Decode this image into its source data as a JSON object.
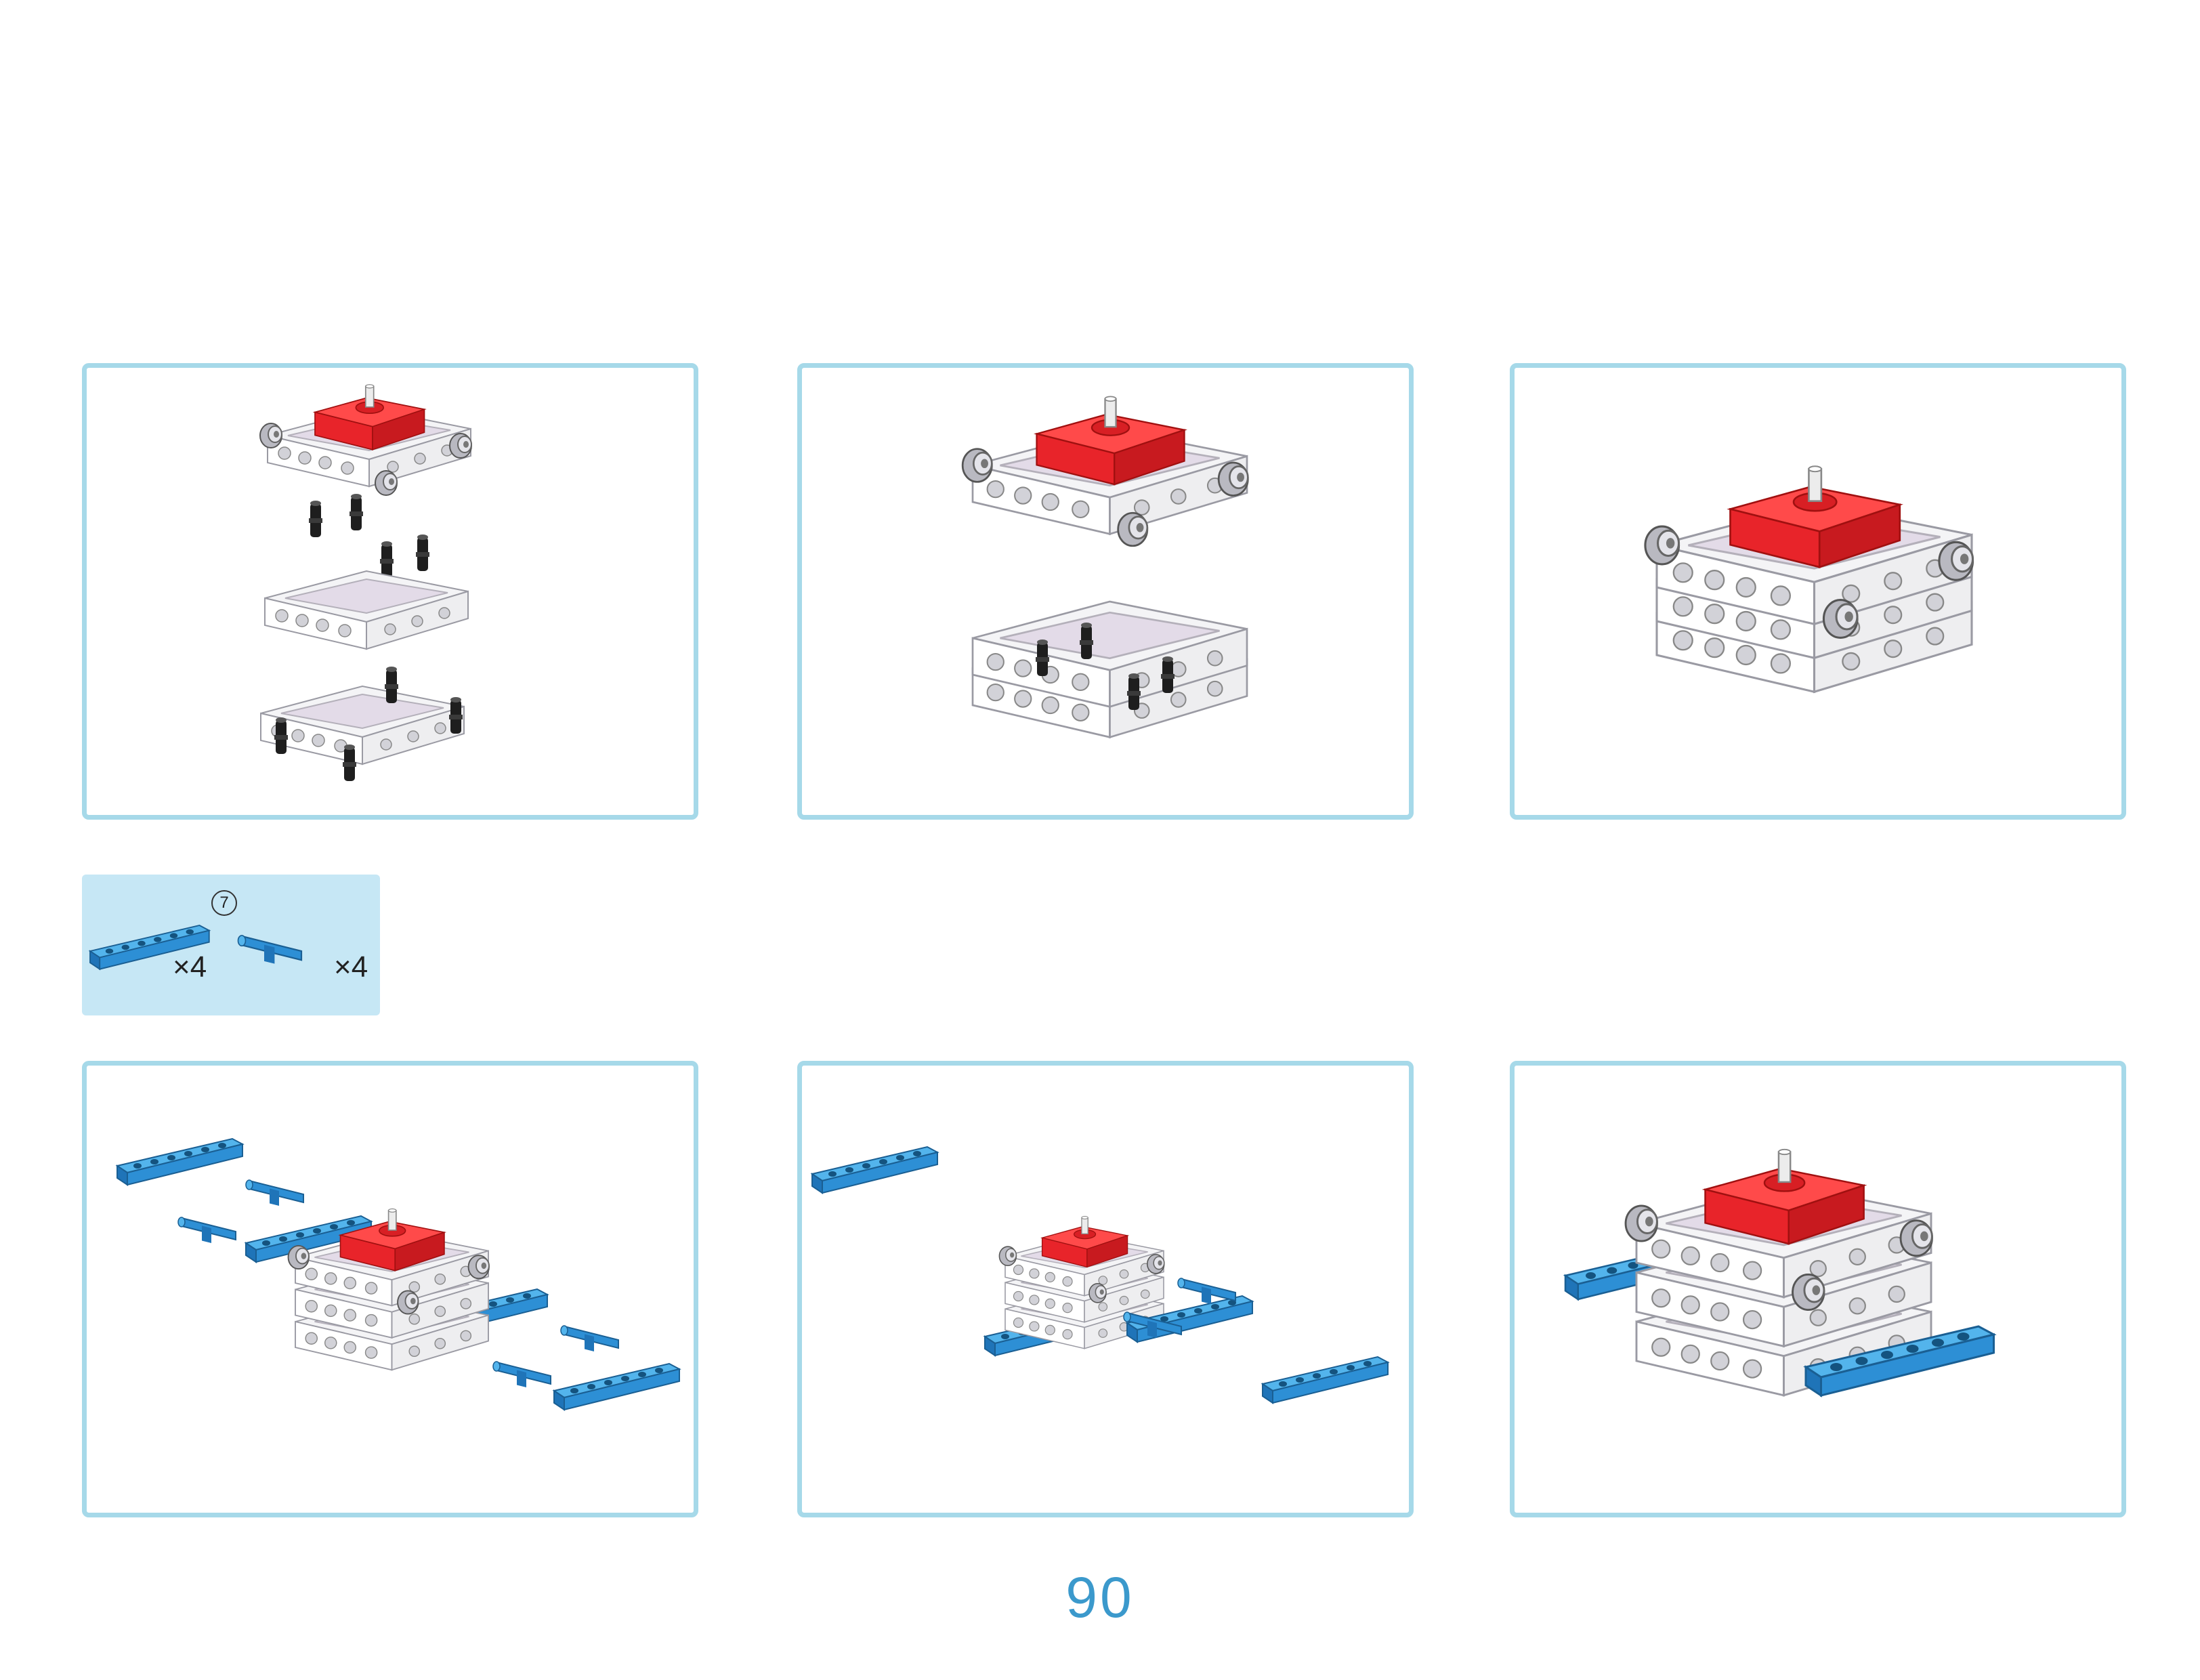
{
  "parts_callout": {
    "step_number": "7",
    "beam_quantity": "×4",
    "pin_quantity": "×4"
  },
  "page_number": "90",
  "colors": {
    "panel_border": "#a6d9e9",
    "parts_box_bg": "#c6e7f5",
    "servo_red": "#e8242a",
    "beam_blue": "#2d8fd5",
    "frame_white": "#f2f2f4",
    "pin_black": "#1e1e1e",
    "page_number": "#3b99cc"
  },
  "icons": [
    "servo-assembly-icon",
    "frame-icon",
    "black-pin-icon",
    "blue-beam-icon",
    "blue-axle-pin-icon"
  ]
}
